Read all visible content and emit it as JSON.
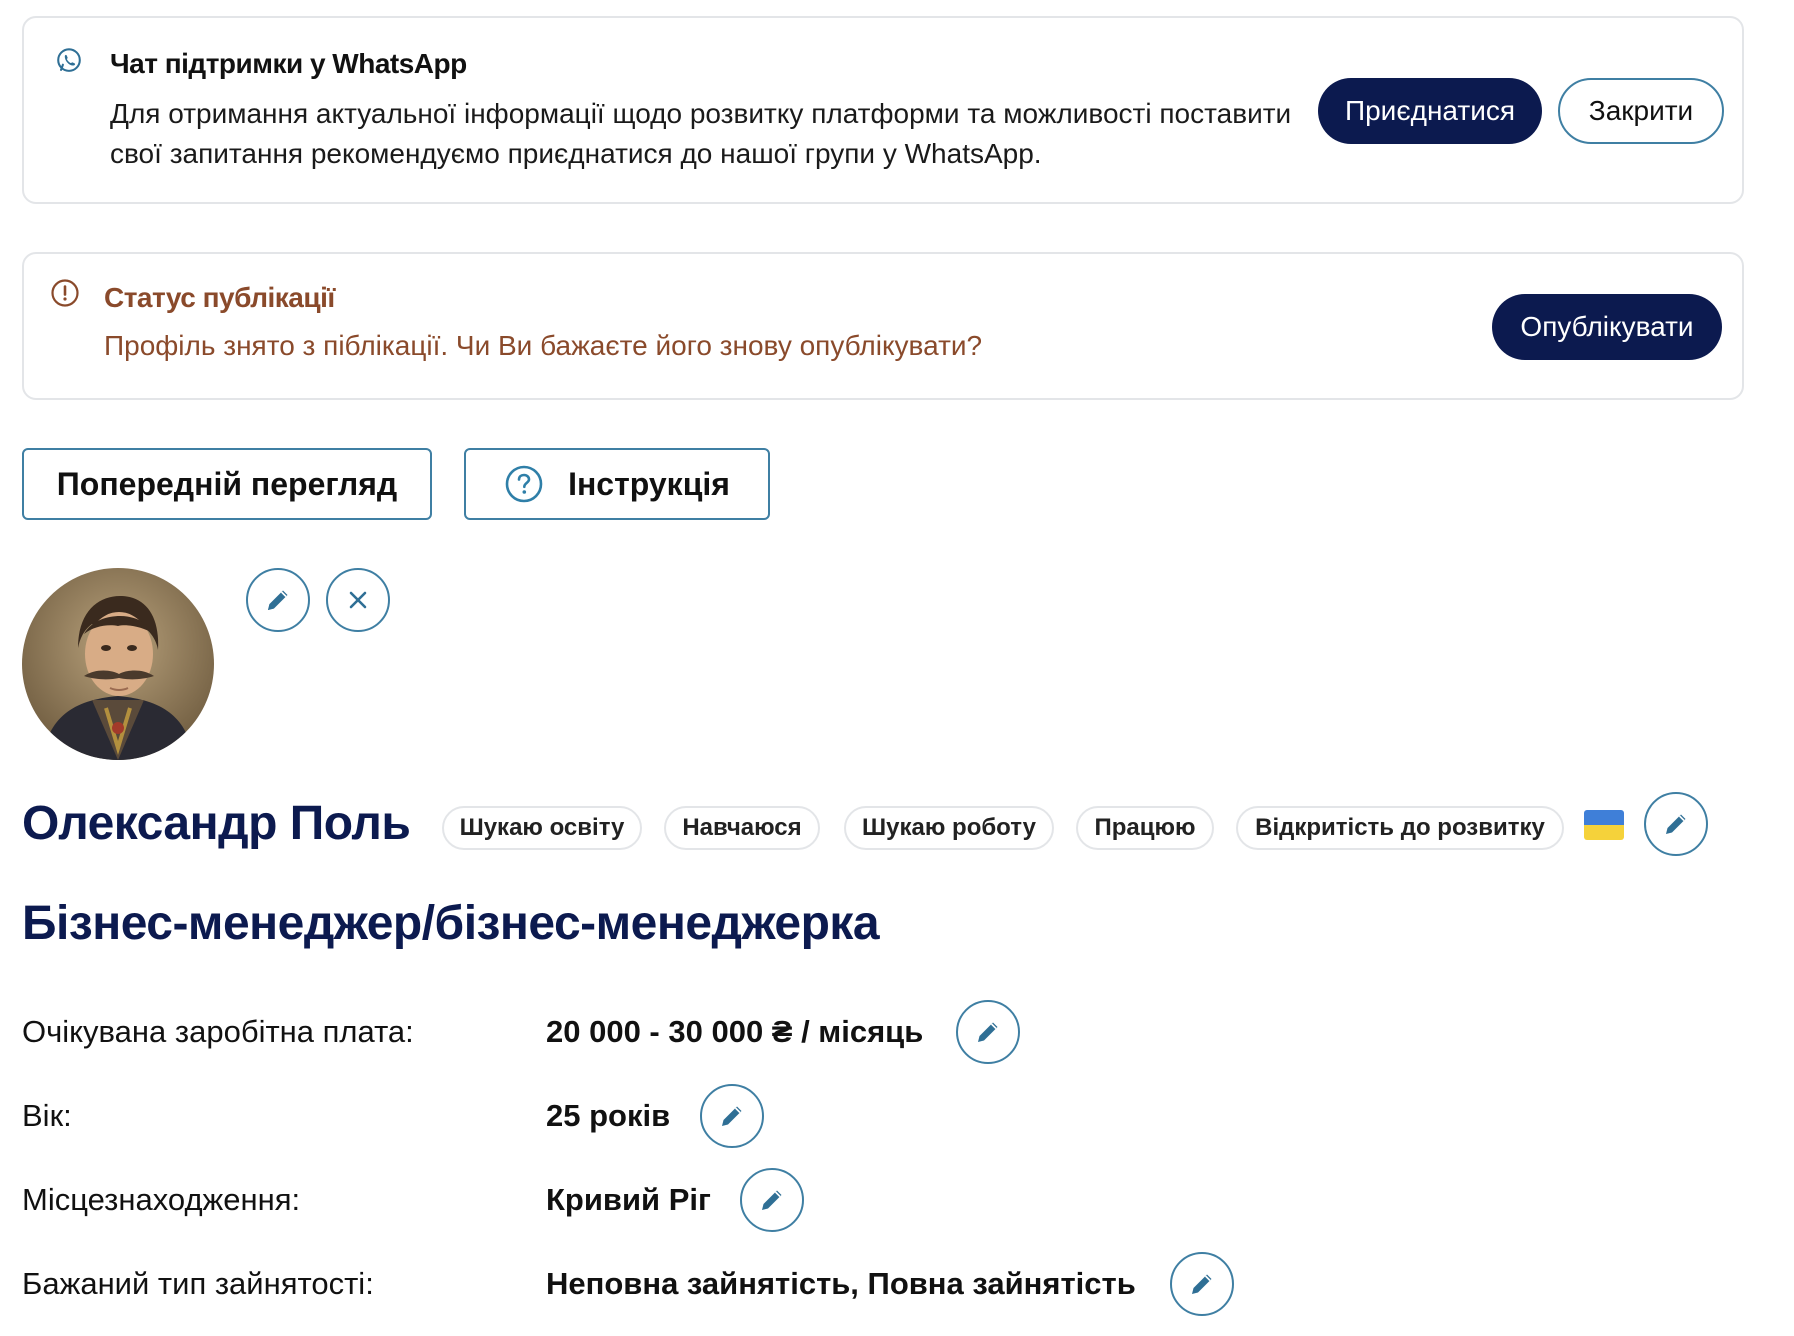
{
  "whatsapp_banner": {
    "title": "Чат підтримки у WhatsApp",
    "text": "Для отримання актуальної інформації щодо розвитку платформи та можливості поставити свої запитання рекомендуємо приєднатися до нашої групи у WhatsApp.",
    "join_label": "Приєднатися",
    "close_label": "Закрити",
    "icon": "whatsapp-icon"
  },
  "status_banner": {
    "title": "Статус публікації",
    "text": "Профіль знято з піблікації. Чи Ви бажаєте його знову опублікувати?",
    "publish_label": "Опублікувати",
    "icon": "alert-circle-icon",
    "color": "#8a4a2b"
  },
  "actions": {
    "preview_label": "Попередній перегляд",
    "guide_label": "Інструкція"
  },
  "profile": {
    "name": "Олександр Поль",
    "tags": [
      "Шукаю освіту",
      "Навчаюся",
      "Шукаю роботу",
      "Працюю",
      "Відкритість до розвитку"
    ],
    "job_title": "Бізнес-менеджер/бізнес-менеджерка"
  },
  "details": [
    {
      "label": "Очікувана заробітна плата:",
      "value": "20 000  - 30 000 ₴ / місяць"
    },
    {
      "label": "Вік:",
      "value": "25 років"
    },
    {
      "label": "Місцезнаходження:",
      "value": "Кривий Ріг"
    },
    {
      "label": "Бажаний тип зайнятості:",
      "value": "Неповна зайнятість, Повна зайнятість"
    }
  ],
  "colors": {
    "primary": "#0c1a4f",
    "accent_border": "#3f7fa3",
    "card_border": "#e3e5e8"
  }
}
